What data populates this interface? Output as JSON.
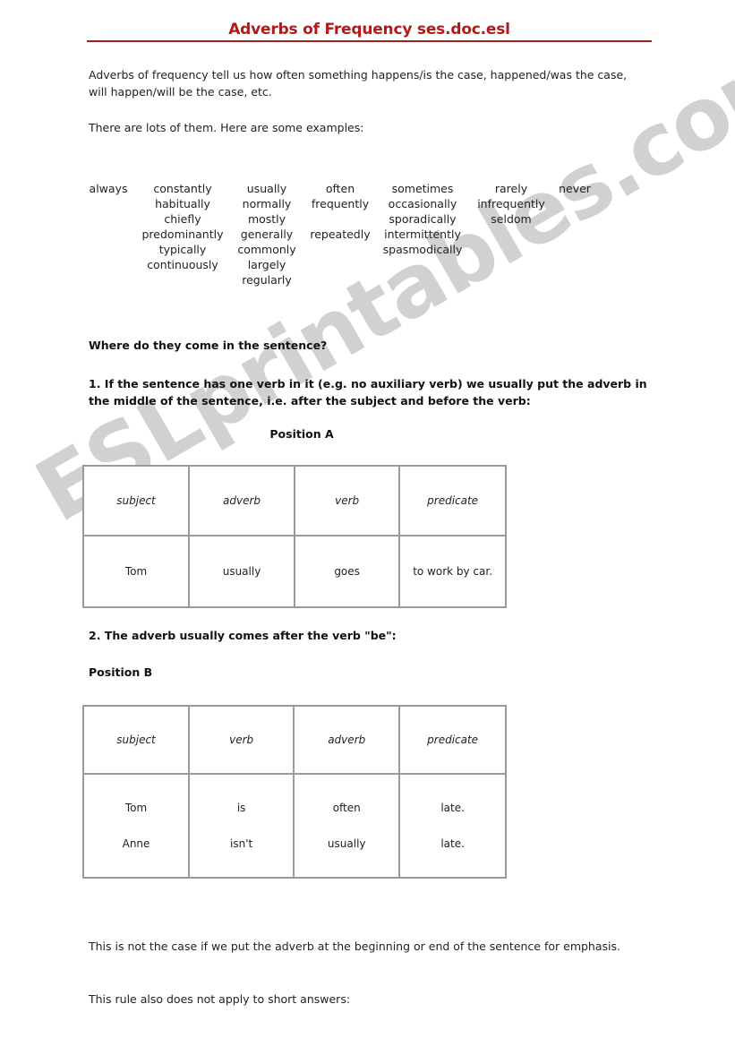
{
  "document": {
    "title": "Adverbs of Frequency ses.doc.esl",
    "watermark": "ESLprintables.com",
    "accent_color": "#b11a1a",
    "rule_color": "#a02020",
    "watermark_color": "#c9c9c9"
  },
  "intro": {
    "paragraph1": "Adverbs of frequency tell us how often something happens/is the case, happened/was the case, will happen/will be the case, etc.",
    "paragraph2": "There are lots of them. Here are some examples:"
  },
  "adverb_columns": [
    {
      "name": "always-column",
      "words": [
        "always"
      ]
    },
    {
      "name": "constantly-column",
      "words": [
        "constantly",
        "habitually",
        "chiefly",
        "predominantly",
        "typically",
        "continuously"
      ]
    },
    {
      "name": "usually-column",
      "words": [
        "usually",
        "normally",
        "mostly",
        "generally",
        "commonly",
        "largely",
        "regularly"
      ]
    },
    {
      "name": "often-column",
      "words": [
        "often",
        "frequently",
        "",
        "repeatedly"
      ]
    },
    {
      "name": "sometimes-column",
      "words": [
        "sometimes",
        "occasionally",
        "sporadically",
        "intermittently",
        "spasmodically"
      ]
    },
    {
      "name": "rarely-column",
      "words": [
        "rarely",
        "infrequently",
        "seldom"
      ]
    },
    {
      "name": "never-column",
      "words": [
        "never"
      ]
    }
  ],
  "section": {
    "question_heading": "Where do they come in the sentence?",
    "rule1": "1. If the sentence has one verb in it (e.g. no auxiliary verb) we usually put the adverb in the middle of the sentence, i.e. after the subject and before the verb:",
    "rule2": "2. The adverb usually comes after the verb \"be\":",
    "position_a_label": "Position A",
    "position_b_label": "Position B"
  },
  "table_a": {
    "headers": [
      "subject",
      "adverb",
      "verb",
      "predicate"
    ],
    "rows": [
      [
        "Tom",
        "usually",
        "goes",
        "to work by car."
      ]
    ]
  },
  "table_b": {
    "headers": [
      "subject",
      "verb",
      "adverb",
      "predicate"
    ],
    "rows": [
      [
        "Tom",
        "is",
        "often",
        "late."
      ],
      [
        "Anne",
        "isn't",
        "usually",
        "late."
      ]
    ]
  },
  "closing": {
    "paragraph1": "This is not the case if we put the adverb at the beginning or end of the sentence for emphasis.",
    "paragraph2": "This rule also does not apply to short answers:"
  }
}
